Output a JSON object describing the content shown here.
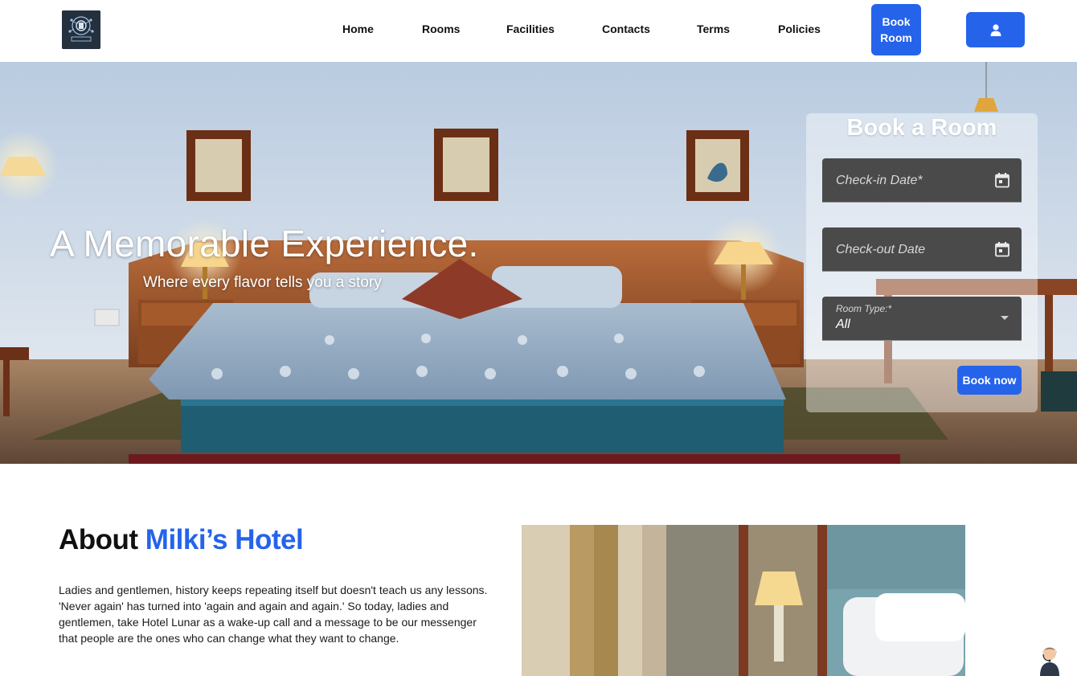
{
  "navbar": {
    "logo_alt": "hotel-logo",
    "links": [
      "Home",
      "Rooms",
      "Facilities",
      "Contacts",
      "Terms",
      "Policies"
    ],
    "book_room_label": "Book Room",
    "user_icon": "user-icon"
  },
  "hero": {
    "title": "A Memorable Experience.",
    "subtitle": "Where every flavor tells you a story"
  },
  "booking": {
    "title": "Book a Room",
    "checkin_placeholder": "Check-in Date*",
    "checkout_placeholder": "Check-out Date",
    "room_type_label": "Room Type:*",
    "room_type_value": "All",
    "submit_label": "Book now",
    "calendar_icon": "calendar-icon"
  },
  "about": {
    "title_prefix": "About ",
    "title_accent": "Milki’s Hotel",
    "body": "Ladies and gentlemen, history keeps repeating itself but doesn't teach us any lessons. 'Never again' has turned into 'again and again and again.' So today, ladies and gentlemen, take Hotel Lunar as a wake-up call and a message to be our messenger that people are the ones who can change what they want to change."
  },
  "colors": {
    "accent": "#2563eb",
    "field_bg": "#4a4a4a"
  }
}
